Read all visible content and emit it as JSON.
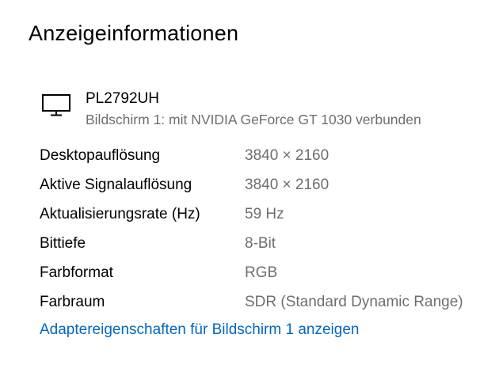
{
  "page": {
    "title": "Anzeigeinformationen"
  },
  "monitor": {
    "icon": "monitor-icon",
    "name": "PL2792UH",
    "subtitle": "Bildschirm 1: mit NVIDIA GeForce GT 1030 verbunden"
  },
  "info": {
    "rows": [
      {
        "label": "Desktopauflösung",
        "value": "3840 × 2160"
      },
      {
        "label": "Aktive Signalauflösung",
        "value": "3840 × 2160"
      },
      {
        "label": "Aktualisierungsrate (Hz)",
        "value": "59 Hz"
      },
      {
        "label": "Bittiefe",
        "value": "8-Bit"
      },
      {
        "label": "Farbformat",
        "value": "RGB"
      },
      {
        "label": "Farbraum",
        "value": "SDR (Standard Dynamic Range)"
      }
    ]
  },
  "links": {
    "adapter_properties": "Adaptereigenschaften für Bildschirm 1 anzeigen"
  },
  "colors": {
    "text_primary": "#000000",
    "text_secondary": "#6e6e6e",
    "link": "#0067c0",
    "background": "#ffffff"
  }
}
